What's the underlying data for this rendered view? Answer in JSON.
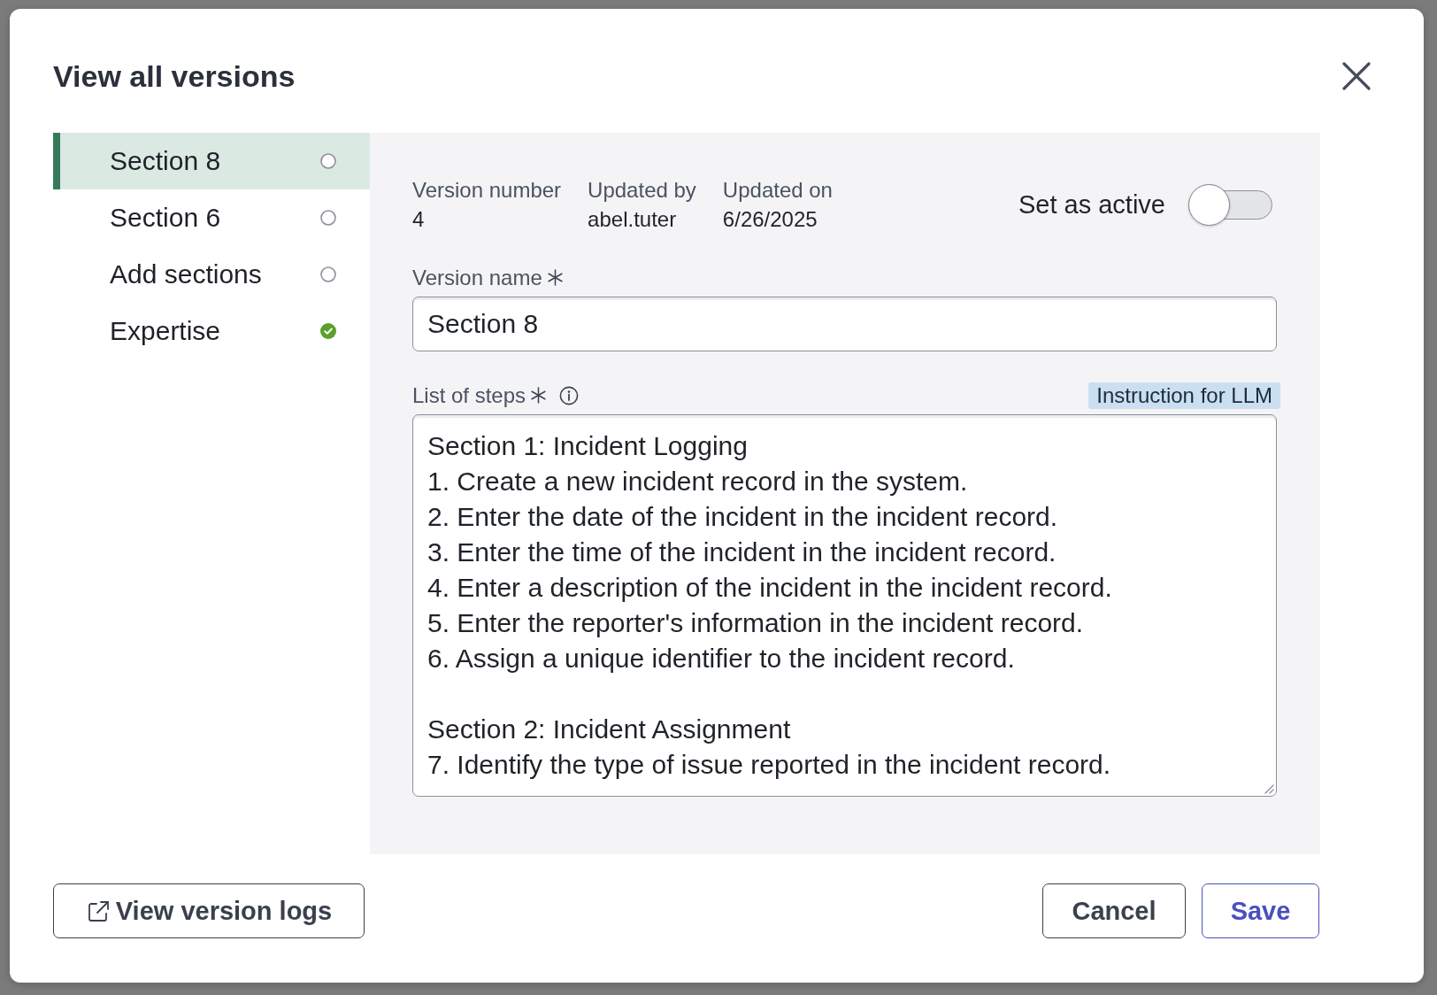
{
  "dialog": {
    "title": "View all versions"
  },
  "versions": [
    {
      "name": "Section 8",
      "selected": true,
      "active": false
    },
    {
      "name": "Section 6",
      "selected": false,
      "active": false
    },
    {
      "name": "Add sections",
      "selected": false,
      "active": false
    },
    {
      "name": "Expertise",
      "selected": false,
      "active": true
    }
  ],
  "details": {
    "meta": [
      {
        "label": "Version number",
        "value": "4"
      },
      {
        "label": "Updated by",
        "value": "abel.tuter"
      },
      {
        "label": "Updated on",
        "value": "6/26/2025"
      }
    ],
    "active_toggle": {
      "label": "Set as active",
      "on": false
    },
    "version_name": {
      "label": "Version name",
      "required": true,
      "value": "Section 8"
    },
    "steps": {
      "label": "List of steps",
      "required": true,
      "tag": "Instruction for LLM",
      "value": "Section 1: Incident Logging\n1. Create a new incident record in the system.\n2. Enter the date of the incident in the incident record.\n3. Enter the time of the incident in the incident record.\n4. Enter a description of the incident in the incident record.\n5. Enter the reporter's information in the incident record.\n6. Assign a unique identifier to the incident record.\n\nSection 2: Incident Assignment\n7. Identify the type of issue reported in the incident record."
    }
  },
  "footer": {
    "logs_button": "View version logs",
    "buttons": [
      {
        "label": "Cancel",
        "kind": "secondary"
      },
      {
        "label": "Save",
        "kind": "primary"
      }
    ]
  }
}
